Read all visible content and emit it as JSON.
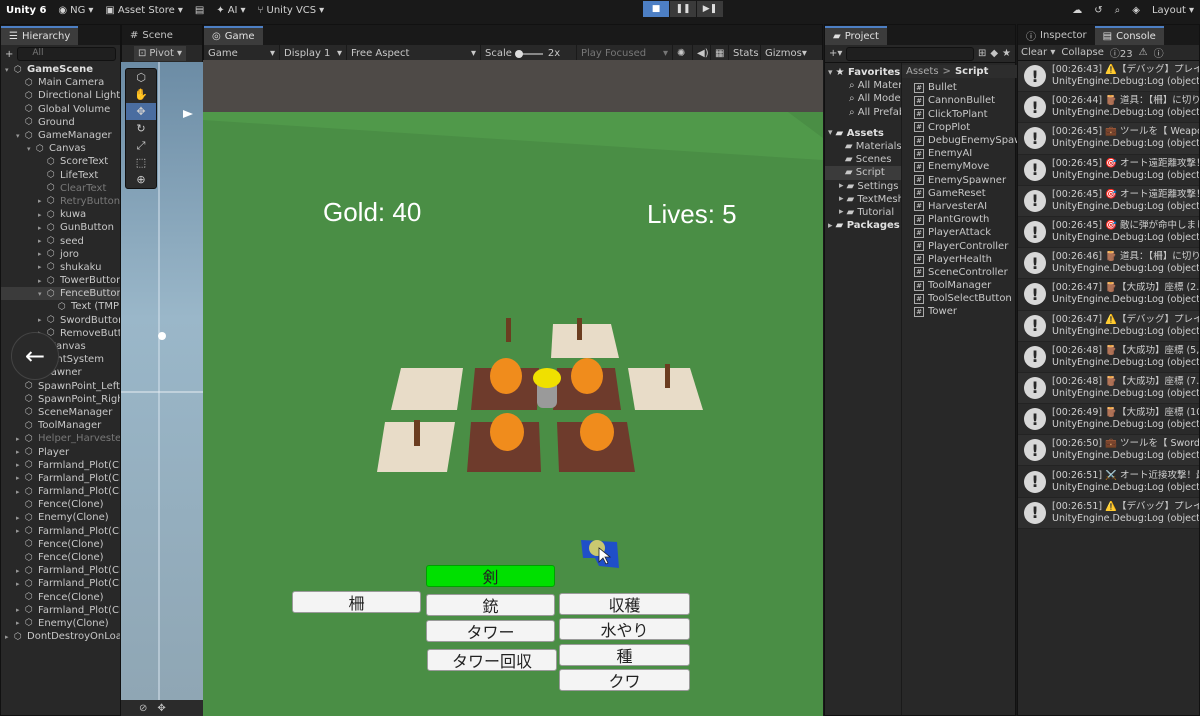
{
  "topbar": {
    "product": "Unity 6",
    "account": "NG",
    "asset_store": "Asset Store",
    "ai": "AI",
    "vcs": "Unity VCS",
    "layout": "Layout"
  },
  "hierarchy": {
    "tab": "Hierarchy",
    "search_placeholder": "All",
    "items": [
      "GameScene",
      "Main Camera",
      "Directional Light",
      "Global Volume",
      "Ground",
      "GameManager",
      "Canvas",
      "ScoreText",
      "LifeText",
      "ClearText",
      "RetryButton",
      "kuwa",
      "GunButton",
      "seed",
      "joro",
      "shukaku",
      "TowerButton",
      "FenceButton",
      "Text (TMP)",
      "SwordButton",
      "RemoveButton",
      "Canvas",
      "EventSystem",
      "Spawner",
      "SpawnPoint_Left",
      "SpawnPoint_Right",
      "SceneManager",
      "ToolManager",
      "Helper_Harvester",
      "Player",
      "Farmland_Plot(Clone)",
      "Farmland_Plot(Clone)",
      "Farmland_Plot(Clone)",
      "Fence(Clone)",
      "Enemy(Clone)",
      "Farmland_Plot(Clone)",
      "Fence(Clone)",
      "Fence(Clone)",
      "Farmland_Plot(Clone)",
      "Farmland_Plot(Clone)",
      "Fence(Clone)",
      "Farmland_Plot(Clone)",
      "Enemy(Clone)",
      "DontDestroyOnLoad"
    ]
  },
  "scene": {
    "tab": "Scene",
    "pivot": "Pivot"
  },
  "game": {
    "tab": "Game",
    "mode": "Game",
    "display": "Display 1",
    "aspect": "Free Aspect",
    "scale_label": "Scale",
    "scale_value": "2x",
    "play_focused": "Play Focused",
    "stats": "Stats",
    "gizmos": "Gizmos",
    "gold": "Gold: 40",
    "lives": "Lives: 5",
    "buttons": {
      "sword": "剣",
      "fence": "柵",
      "gun": "銃",
      "tower": "タワー",
      "tower_remove": "タワー回収",
      "harvest": "収穫",
      "water": "水やり",
      "seed": "種",
      "hoe": "クワ"
    }
  },
  "project": {
    "tab": "Project",
    "favorites": "Favorites",
    "fav_items": [
      "All Materials",
      "All Models",
      "All Prefabs"
    ],
    "assets": "Assets",
    "asset_folders": [
      "Materials",
      "Scenes",
      "Script",
      "Settings",
      "TextMesh Pro",
      "Tutorial"
    ],
    "packages": "Packages",
    "breadcrumb_root": "Assets",
    "breadcrumb_current": "Script",
    "scripts": [
      "Bullet",
      "CannonBullet",
      "ClickToPlant",
      "CropPlot",
      "DebugEnemySpawner",
      "EnemyAI",
      "EnemyMove",
      "EnemySpawner",
      "GameReset",
      "HarvesterAI",
      "PlantGrowth",
      "PlayerAttack",
      "PlayerController",
      "PlayerHealth",
      "SceneController",
      "ToolManager",
      "ToolSelectButton",
      "Tower"
    ]
  },
  "console": {
    "inspector_tab": "Inspector",
    "console_tab": "Console",
    "clear": "Clear",
    "collapse": "Collapse",
    "count_info": "23",
    "logs": [
      {
        "time": "[00:26:43]",
        "msg": "⚠️【デバッグ】プレイヤーを",
        "sub": "UnityEngine.Debug:Log (object)"
      },
      {
        "time": "[00:26:44]",
        "msg": "🪵 道具：【柵】に切り替",
        "sub": "UnityEngine.Debug:Log (object)"
      },
      {
        "time": "[00:26:45]",
        "msg": "💼 ツールを【 Weapon 】",
        "sub": "UnityEngine.Debug:Log (object)"
      },
      {
        "time": "[00:26:45]",
        "msg": "🎯 オート遠距離攻撃！",
        "sub": "UnityEngine.Debug:Log (object)"
      },
      {
        "time": "[00:26:45]",
        "msg": "🎯 オート遠距離攻撃！",
        "sub": "UnityEngine.Debug:Log (object)"
      },
      {
        "time": "[00:26:45]",
        "msg": "🎯 敵に弾が命中しました",
        "sub": "UnityEngine.Debug:Log (object)"
      },
      {
        "time": "[00:26:46]",
        "msg": "🪵 道具：【柵】に切り替",
        "sub": "UnityEngine.Debug:Log (object)"
      },
      {
        "time": "[00:26:47]",
        "msg": "🪵【大成功】座標 (2.5",
        "sub": "UnityEngine.Debug:Log (object)"
      },
      {
        "time": "[00:26:47]",
        "msg": "⚠️【デバッグ】プレイヤーを",
        "sub": "UnityEngine.Debug:Log (object)"
      },
      {
        "time": "[00:26:48]",
        "msg": "🪵【大成功】座標 (5,",
        "sub": "UnityEngine.Debug:Log (object)"
      },
      {
        "time": "[00:26:48]",
        "msg": "🪵【大成功】座標 (7.5",
        "sub": "UnityEngine.Debug:Log (object)"
      },
      {
        "time": "[00:26:49]",
        "msg": "🪵【大成功】座標 (10",
        "sub": "UnityEngine.Debug:Log (object)"
      },
      {
        "time": "[00:26:50]",
        "msg": "💼 ツールを【 Sword 】に",
        "sub": "UnityEngine.Debug:Log (object)"
      },
      {
        "time": "[00:26:51]",
        "msg": "⚔️ オート近接攻撃！最",
        "sub": "UnityEngine.Debug:Log (object)"
      },
      {
        "time": "[00:26:51]",
        "msg": "⚠️【デバッグ】プレイヤーを",
        "sub": "UnityEngine.Debug:Log (object)"
      }
    ]
  }
}
